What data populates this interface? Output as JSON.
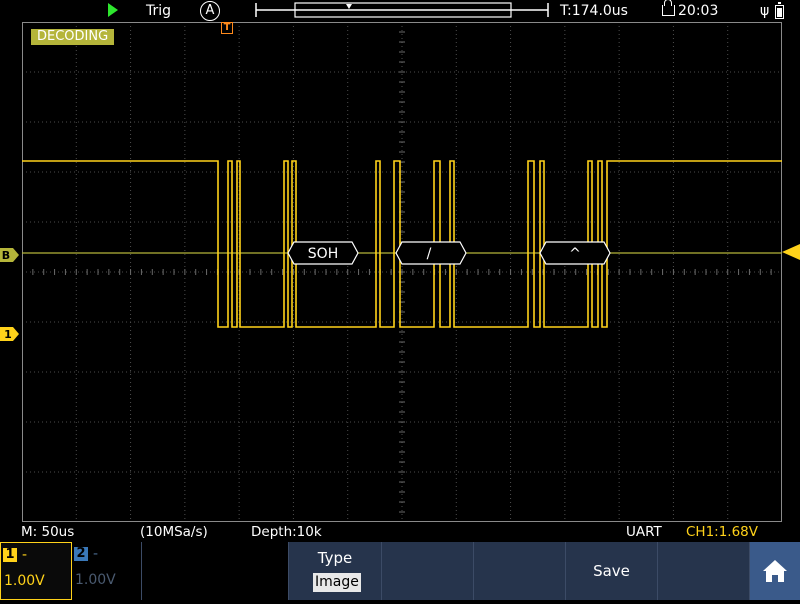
{
  "top": {
    "trig_label": "Trig",
    "trig_mode": "A",
    "time": "T:174.0us",
    "clock": "20:03"
  },
  "screen": {
    "decoding_label": "DECODING",
    "trigger_marker": "T",
    "decoded_frames": [
      "SOH",
      "/",
      "^"
    ],
    "channel_marker_b": "B",
    "channel_marker_1": "1"
  },
  "status": {
    "timebase": "M: 50us",
    "sample_rate": "(10MSa/s)",
    "depth": "Depth:10k",
    "decoder": "UART",
    "ch_level": "CH1:1.68V"
  },
  "softkeys": {
    "ch1": {
      "num": "1",
      "dash": "-",
      "volt": "1.00V"
    },
    "ch2": {
      "num": "2",
      "dash": "-",
      "volt": "1.00V"
    },
    "type_label": "Type",
    "type_value": "Image",
    "save_label": "Save"
  },
  "colors": {
    "trace": "#ffd21a",
    "grid": "#4a4a4a",
    "decode_bus": "#b5b53a",
    "run": "#2ee62e",
    "softbar": "#26344c"
  },
  "icons": [
    "run-icon",
    "lock-icon",
    "usb-icon",
    "battery-icon",
    "home-icon"
  ]
}
